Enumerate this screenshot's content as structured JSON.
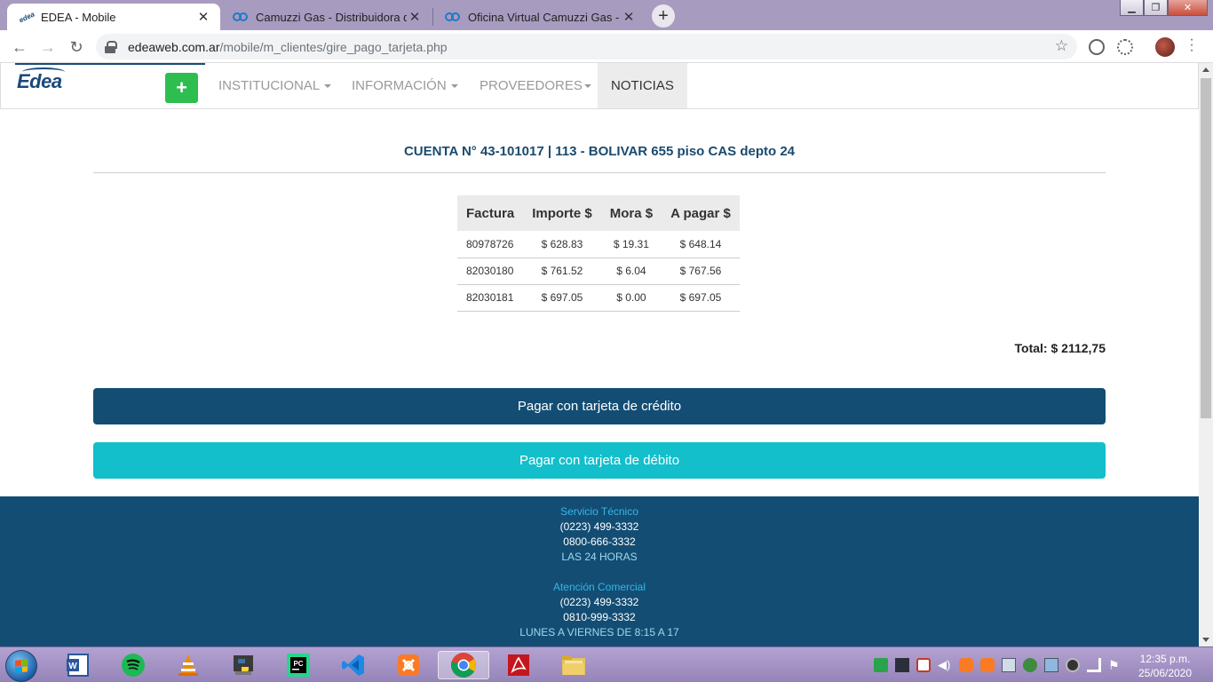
{
  "browser": {
    "tabs": [
      {
        "title": "EDEA - Mobile",
        "active": true
      },
      {
        "title": "Camuzzi Gas - Distribuidora de Gas",
        "active": false
      },
      {
        "title": "Oficina Virtual Camuzzi Gas - Distribuidora",
        "active": false
      }
    ],
    "url_host": "edeaweb.com.ar",
    "url_path": "/mobile/m_clientes/gire_pago_tarjeta.php"
  },
  "header": {
    "logo_text": "Edea",
    "plus_label": "+",
    "nav": [
      {
        "label": "INSTITUCIONAL",
        "dropdown": true
      },
      {
        "label": "INFORMACIÓN",
        "dropdown": true
      },
      {
        "label": "PROVEEDORES",
        "dropdown": true
      },
      {
        "label": "NOTICIAS",
        "dropdown": false
      }
    ]
  },
  "account": {
    "title": "CUENTA N° 43-101017 | 113 - BOLIVAR 655 piso CAS depto 24"
  },
  "invoices": {
    "headers": [
      "Factura",
      "Importe $",
      "Mora $",
      "A pagar $"
    ],
    "rows": [
      [
        "80978726",
        "$ 628.83",
        "$ 19.31",
        "$ 648.14"
      ],
      [
        "82030180",
        "$ 761.52",
        "$ 6.04",
        "$ 767.56"
      ],
      [
        "82030181",
        "$ 697.05",
        "$ 0.00",
        "$ 697.05"
      ]
    ]
  },
  "total": "Total: $ 2112,75",
  "buttons": {
    "credit": "Pagar con tarjeta de crédito",
    "debit": "Pagar con tarjeta de débito"
  },
  "footer": {
    "service_title": "Servicio Técnico",
    "service_phone1": "(0223) 499-3332",
    "service_phone2": "0800-666-3332",
    "service_hours": "LAS 24 HORAS",
    "commercial_title": "Atención Comercial",
    "commercial_phone1": "(0223) 499-3332",
    "commercial_phone2": "0810-999-3332",
    "commercial_hours": "LUNES A VIERNES DE 8:15 A 17"
  },
  "taskbar": {
    "apps": [
      "word-icon",
      "spotify-icon",
      "vlc-icon",
      "python-icon",
      "pycharm-icon",
      "vscode-icon",
      "xampp-icon",
      "chrome-icon",
      "acrobat-icon",
      "explorer-icon"
    ],
    "time": "12:35 p.m.",
    "date": "25/06/2020"
  },
  "colors": {
    "primary": "#134d73",
    "accent": "#12bfcb",
    "plus_green": "#2ebd4f",
    "footer_heading": "#36b6e8"
  }
}
